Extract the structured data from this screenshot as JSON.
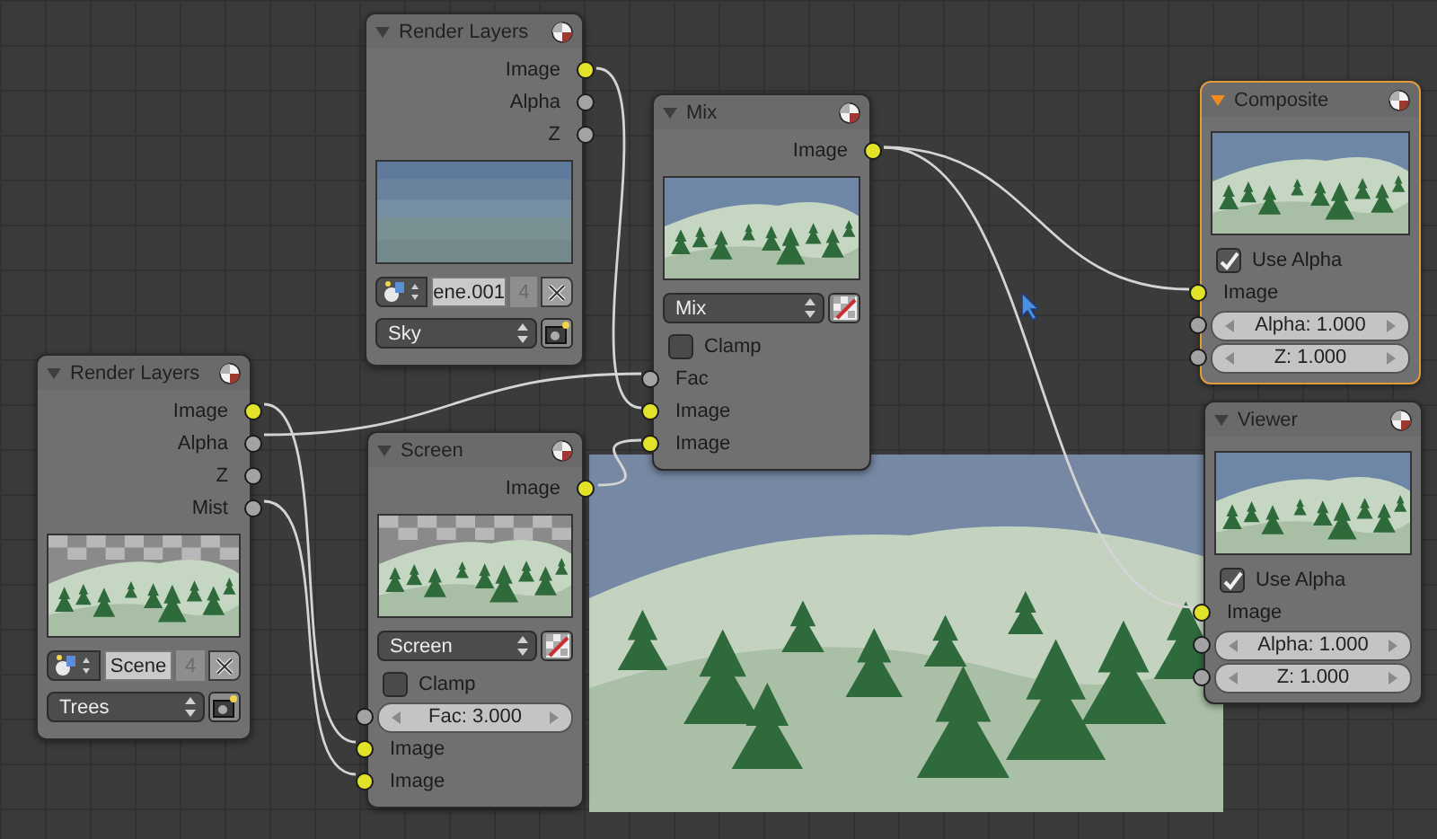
{
  "nodes": [
    {
      "title": "Render Layers",
      "selected": false,
      "items": [
        {
          "kind": "output",
          "label": "Image",
          "color": "#e3e22a"
        },
        {
          "kind": "output",
          "label": "Alpha",
          "color": "#a3a3a3"
        },
        {
          "kind": "output",
          "label": "Z",
          "color": "#a3a3a3"
        },
        {
          "kind": "preview"
        },
        {
          "kind": "scene",
          "value": "ene.001",
          "users": "4"
        },
        {
          "kind": "layer",
          "value": "Sky"
        }
      ]
    },
    {
      "title": "Mix",
      "selected": false,
      "items": [
        {
          "kind": "output",
          "label": "Image",
          "color": "#e3e22a"
        },
        {
          "kind": "preview"
        },
        {
          "kind": "blend",
          "value": "Mix"
        },
        {
          "kind": "checkbox",
          "label": "Clamp",
          "checked": false
        },
        {
          "kind": "input",
          "label": "Fac",
          "color": "#a3a3a3"
        },
        {
          "kind": "input",
          "label": "Image",
          "color": "#e3e22a"
        },
        {
          "kind": "input",
          "label": "Image",
          "color": "#e3e22a"
        }
      ]
    },
    {
      "title": "Composite",
      "selected": true,
      "items": [
        {
          "kind": "preview"
        },
        {
          "kind": "checkbox",
          "label": "Use Alpha",
          "checked": true
        },
        {
          "kind": "input",
          "label": "Image",
          "color": "#e3e22a"
        },
        {
          "kind": "slider",
          "label": "Alpha: 1.000",
          "color": "#a3a3a3"
        },
        {
          "kind": "slider",
          "label": "Z: 1.000",
          "color": "#a3a3a3"
        }
      ]
    },
    {
      "title": "Render Layers",
      "selected": false,
      "items": [
        {
          "kind": "output",
          "label": "Image",
          "color": "#e3e22a"
        },
        {
          "kind": "output",
          "label": "Alpha",
          "color": "#a3a3a3"
        },
        {
          "kind": "output",
          "label": "Z",
          "color": "#a3a3a3"
        },
        {
          "kind": "output",
          "label": "Mist",
          "color": "#a3a3a3"
        },
        {
          "kind": "preview"
        },
        {
          "kind": "scene",
          "value": "Scene",
          "users": "4"
        },
        {
          "kind": "layer",
          "value": "Trees"
        }
      ]
    },
    {
      "title": "Screen",
      "selected": false,
      "items": [
        {
          "kind": "output",
          "label": "Image",
          "color": "#e3e22a"
        },
        {
          "kind": "preview"
        },
        {
          "kind": "blend",
          "value": "Screen"
        },
        {
          "kind": "checkbox",
          "label": "Clamp",
          "checked": false
        },
        {
          "kind": "slider",
          "label": "Fac: 3.000",
          "color": "#a3a3a3"
        },
        {
          "kind": "input",
          "label": "Image",
          "color": "#e3e22a"
        },
        {
          "kind": "input",
          "label": "Image",
          "color": "#e3e22a"
        }
      ]
    },
    {
      "title": "Viewer",
      "selected": false,
      "items": [
        {
          "kind": "preview"
        },
        {
          "kind": "checkbox",
          "label": "Use Alpha",
          "checked": true
        },
        {
          "kind": "input",
          "label": "Image",
          "color": "#e3e22a"
        },
        {
          "kind": "slider",
          "label": "Alpha: 1.000",
          "color": "#a3a3a3"
        },
        {
          "kind": "slider",
          "label": "Z: 1.000",
          "color": "#a3a3a3"
        }
      ]
    }
  ]
}
